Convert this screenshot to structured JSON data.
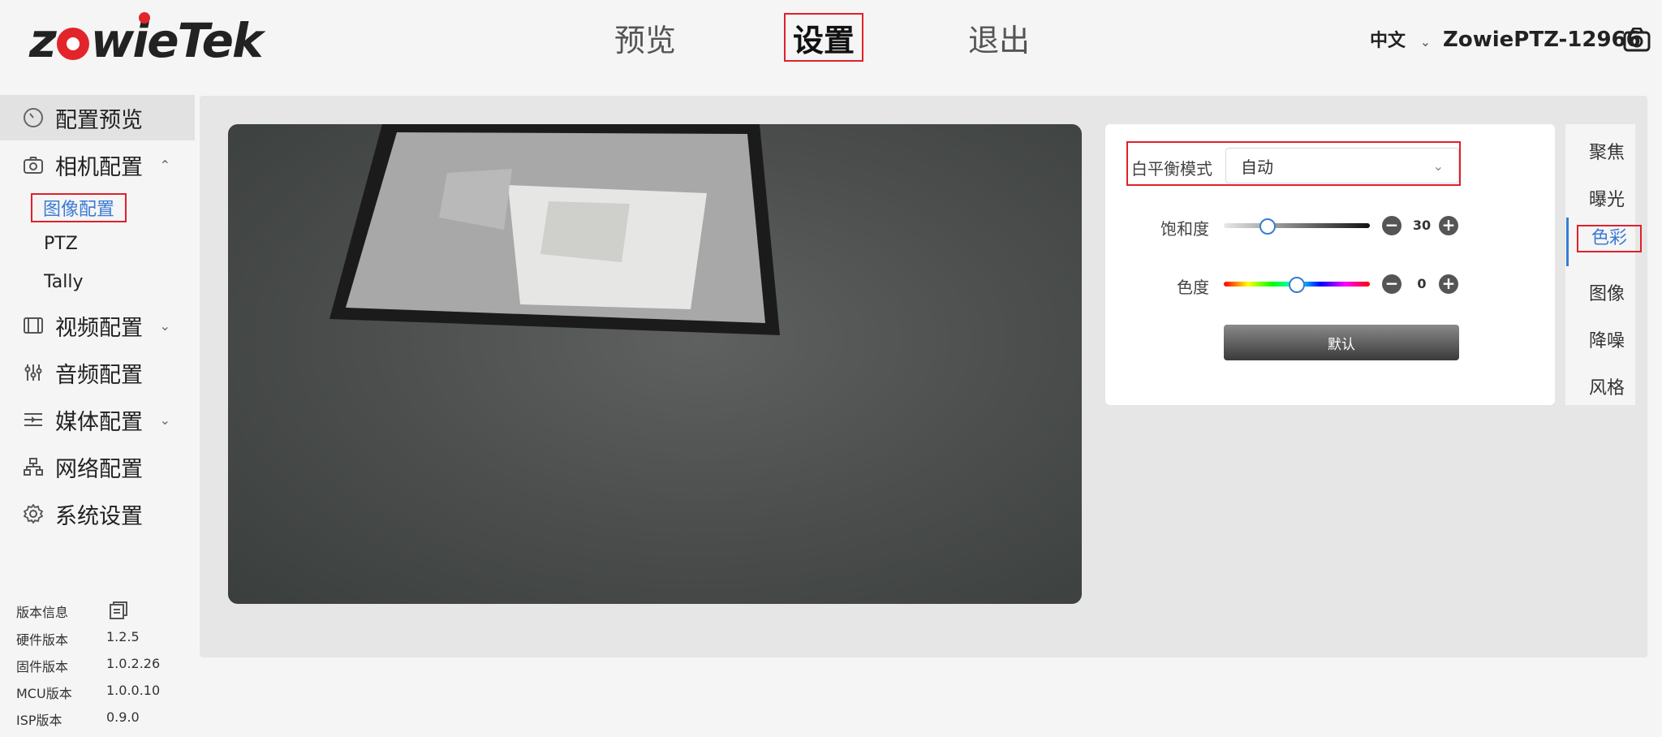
{
  "header": {
    "logo": "zowieTek",
    "nav": {
      "preview": "预览",
      "settings": "设置",
      "logout": "退出"
    },
    "language": "中文",
    "device_name": "ZowiePTZ-12966"
  },
  "sidebar": {
    "items": [
      {
        "label": "配置预览",
        "icon": "dashboard-icon"
      },
      {
        "label": "相机配置",
        "icon": "camera-icon"
      },
      {
        "label": "视频配置",
        "icon": "video-icon"
      },
      {
        "label": "音频配置",
        "icon": "audio-mixer-icon"
      },
      {
        "label": "媒体配置",
        "icon": "media-icon"
      },
      {
        "label": "网络配置",
        "icon": "network-icon"
      },
      {
        "label": "系统设置",
        "icon": "gear-icon"
      }
    ],
    "camera_sub": [
      "图像配置",
      "PTZ",
      "Tally"
    ],
    "version": {
      "title": "版本信息",
      "rows": [
        {
          "label": "硬件版本",
          "value": "1.2.5"
        },
        {
          "label": "固件版本",
          "value": "1.0.2.26"
        },
        {
          "label": "MCU版本",
          "value": "1.0.0.10"
        },
        {
          "label": "ISP版本",
          "value": "0.9.0"
        }
      ]
    }
  },
  "settings": {
    "wb_label": "白平衡模式",
    "wb_value": "自动",
    "saturation_label": "饱和度",
    "saturation_value": "30",
    "saturation_fraction": 0.3,
    "hue_label": "色度",
    "hue_value": "0",
    "hue_fraction": 0.5,
    "default_button": "默认"
  },
  "right_tabs": [
    "聚焦",
    "曝光",
    "色彩",
    "图像",
    "降噪",
    "风格"
  ],
  "colors": {
    "accent": "#3a7bd5",
    "highlight_border": "#e0202a",
    "brand_red": "#e2252b"
  }
}
